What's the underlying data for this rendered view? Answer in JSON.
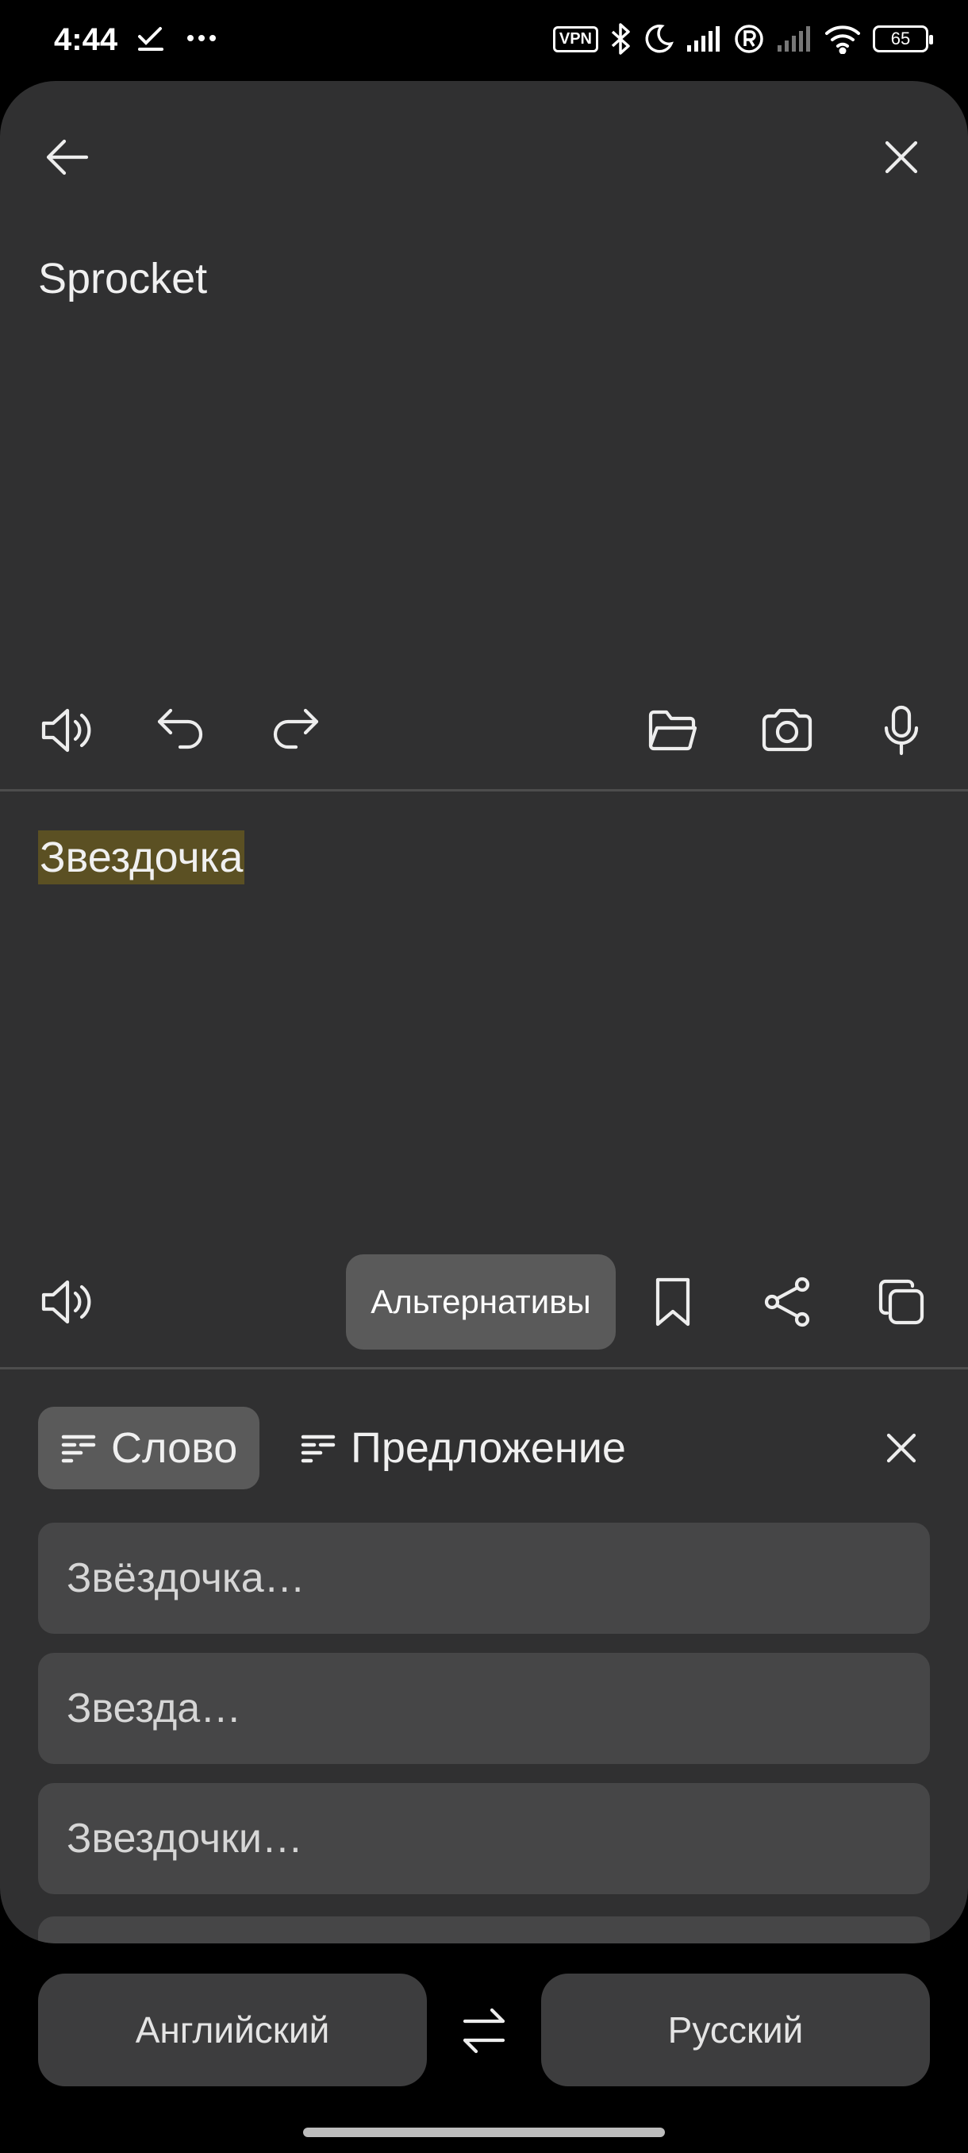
{
  "status_bar": {
    "time": "4:44",
    "vpn_label": "VPN",
    "battery_level": "65"
  },
  "editor": {
    "source_text": "Sprocket",
    "translation_text": "Звездочка"
  },
  "actions": {
    "alternatives_label": "Альтернативы"
  },
  "alternatives_panel": {
    "tabs": [
      {
        "label": "Слово",
        "active": true
      },
      {
        "label": "Предложение",
        "active": false
      }
    ],
    "items": [
      "Звёздочка…",
      "Звезда…",
      "Звездочки…"
    ]
  },
  "languages": {
    "source": "Английский",
    "target": "Русский"
  },
  "colors": {
    "panel_background": "#303031",
    "highlight": "#5b5023",
    "chip_active": "#5a5a5a",
    "list_item": "#464647"
  }
}
